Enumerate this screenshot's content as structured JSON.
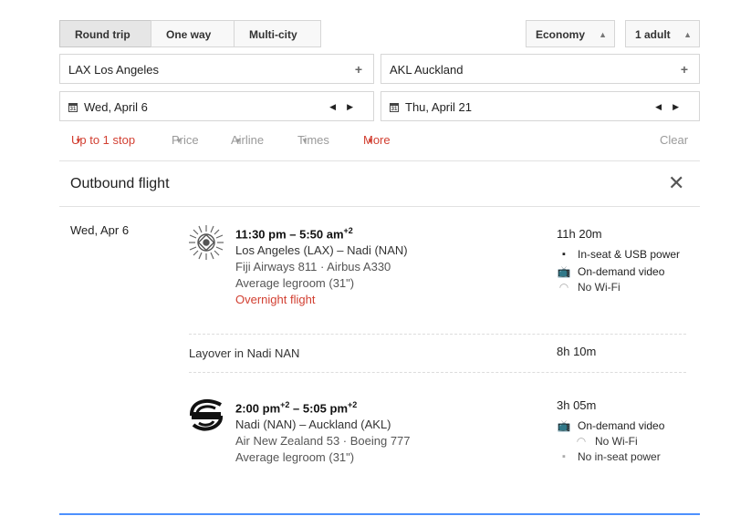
{
  "trip_type": {
    "options": [
      "Round trip",
      "One way",
      "Multi-city"
    ],
    "selected": "Round trip"
  },
  "cabin_class": "Economy",
  "passengers": "1 adult",
  "origin": "LAX Los Angeles",
  "destination": "AKL Auckland",
  "depart_date": "Wed, April 6",
  "return_date": "Thu, April 21",
  "calendar_icon_text": "31",
  "filters": {
    "stops": "Up to 1 stop",
    "price": "Price",
    "airline": "Airline",
    "times": "Times",
    "more": "More",
    "clear": "Clear"
  },
  "outbound": {
    "title": "Outbound flight",
    "date": "Wed, Apr 6",
    "segments": [
      {
        "logo": "fiji-airways-logo",
        "time_start": "11:30 pm – 5:50 am",
        "time_start_sup": "",
        "time_end_sup": "+2",
        "route": "Los Angeles (LAX) – Nadi (NAN)",
        "flight": "Fiji Airways 811 · Airbus A330",
        "legroom": "Average legroom (31\")",
        "note": "Overnight flight",
        "duration": "11h 20m",
        "amenities": [
          {
            "icon": "power-plug-icon",
            "text": "In-seat & USB power"
          },
          {
            "icon": "video-icon",
            "text": "On-demand video"
          },
          {
            "icon": "wifi-icon",
            "text": "No Wi-Fi"
          }
        ]
      },
      {
        "logo": "air-new-zealand-logo",
        "time_a": "2:00 pm",
        "time_a_sup": "+2",
        "time_b": "5:05 pm",
        "time_b_sup": "+2",
        "route": "Nadi (NAN) – Auckland (AKL)",
        "flight": "Air New Zealand 53 · Boeing 777",
        "legroom": "Average legroom (31\")",
        "duration": "3h 05m",
        "amenities": [
          {
            "icon": "video-icon",
            "text": "On-demand video"
          },
          {
            "icon": "wifi-icon",
            "text": "No Wi-Fi"
          },
          {
            "icon": "power-plug-icon",
            "text": "No in-seat power"
          }
        ]
      }
    ],
    "layover": {
      "text": "Layover in Nadi NAN",
      "duration": "8h 10m"
    }
  }
}
